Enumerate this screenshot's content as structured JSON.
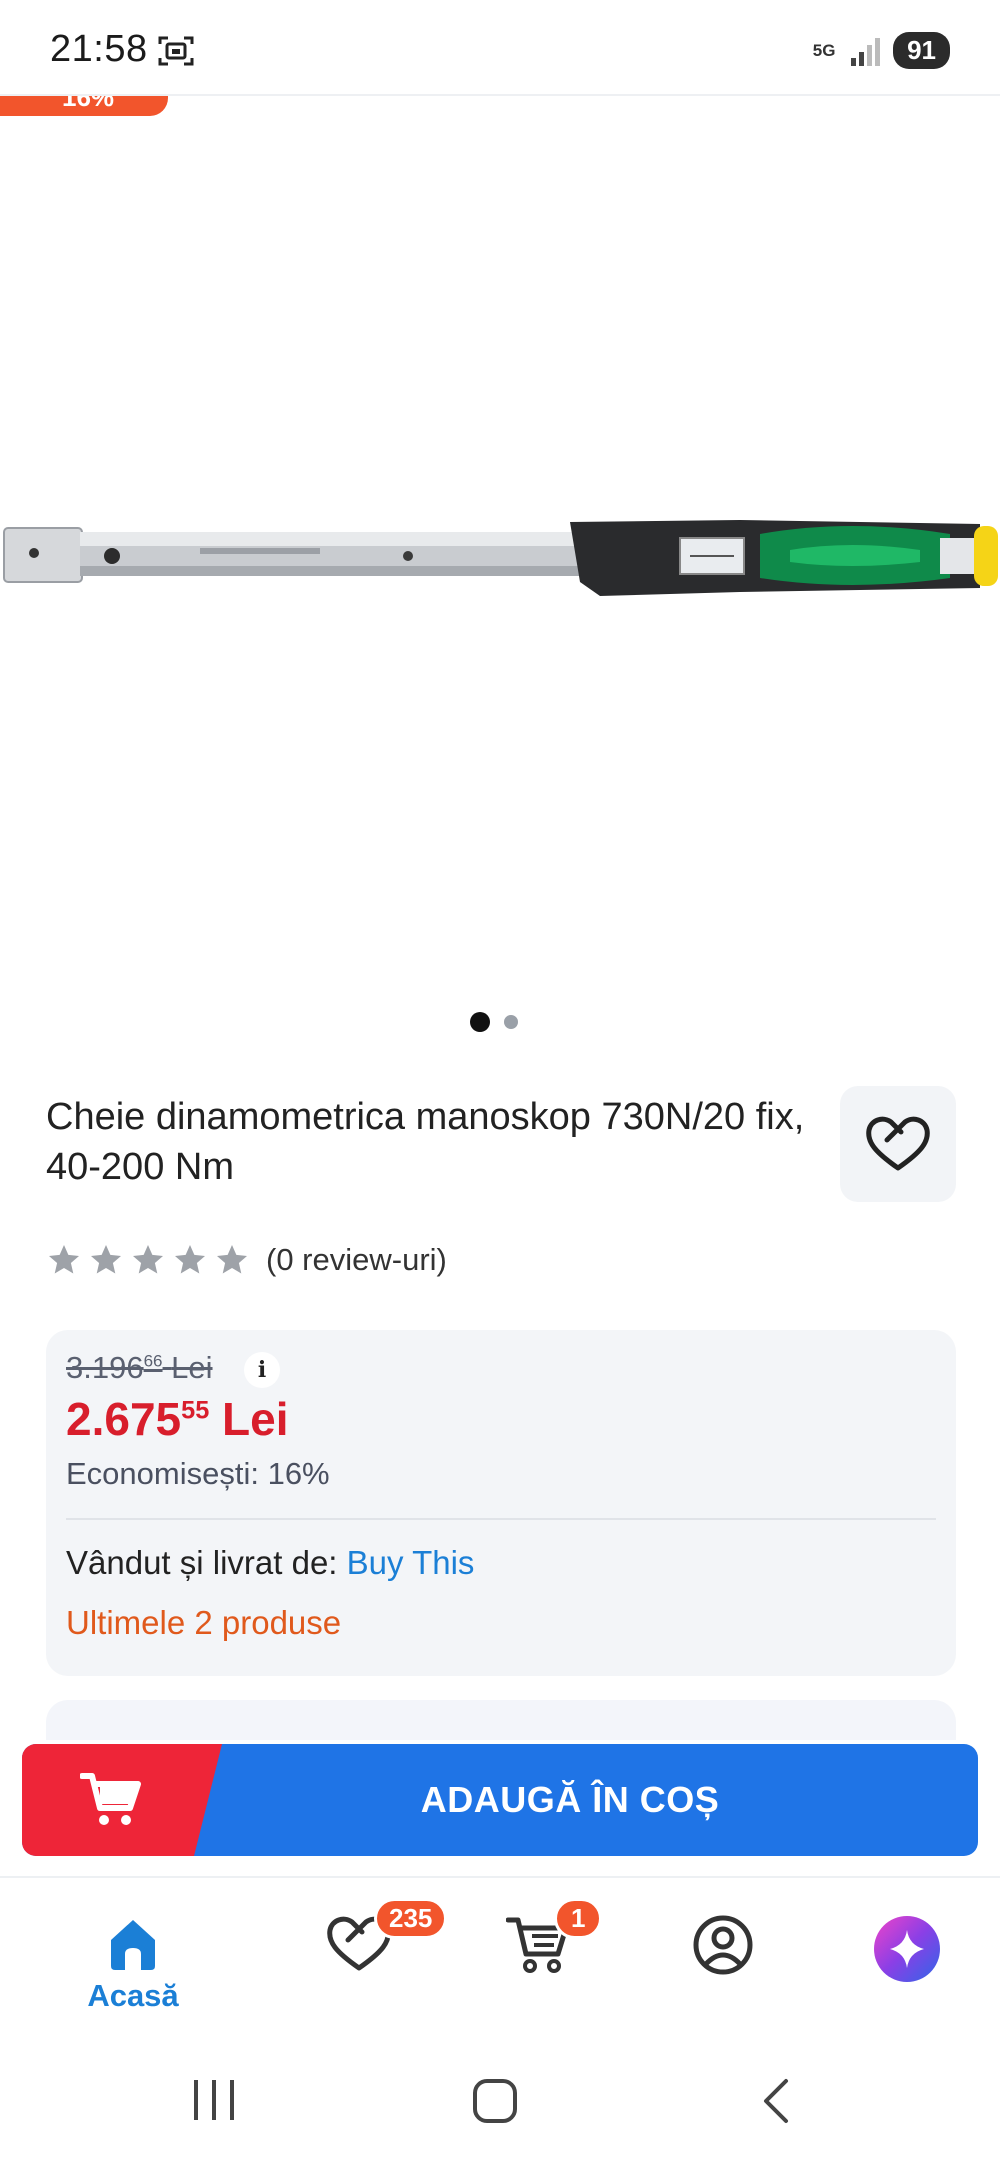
{
  "status_bar": {
    "time": "21:58",
    "network": "5G",
    "battery": "91"
  },
  "ribbon": {
    "text": "16%"
  },
  "gallery": {
    "current_index": 1,
    "total": 2
  },
  "product": {
    "title": "Cheie dinamometrica manoskop 730N/20 fix, 40-200 Nm",
    "rating": {
      "stars": 0,
      "max": 5,
      "reviews_label": "(0 review-uri)"
    }
  },
  "price": {
    "old_main": "3.196",
    "old_cents": "66",
    "old_currency": "Lei",
    "new_main": "2.675",
    "new_cents": "55",
    "new_currency": "Lei",
    "savings": "Economisești: 16%",
    "info_icon": "i"
  },
  "seller": {
    "prefix": "Vândut și livrat de:",
    "name": "Buy This",
    "stock": "Ultimele 2 produse"
  },
  "cart_button": {
    "label": "ADAUGĂ ÎN COȘ"
  },
  "bottom_nav": {
    "home_label": "Acasă",
    "favorites_badge": "235",
    "cart_badge": "1"
  },
  "colors": {
    "accent_blue": "#1f74e6",
    "accent_red": "#ee2538",
    "price_red": "#d81e2c",
    "stock_orange": "#e0591c",
    "badge_orange": "#f2552c"
  }
}
